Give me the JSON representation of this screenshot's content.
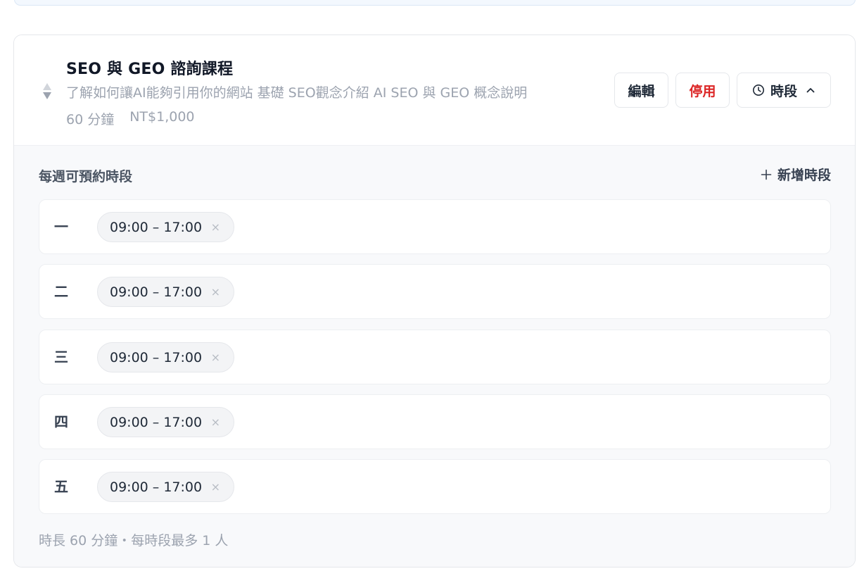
{
  "course": {
    "title": "SEO 與 GEO 諮詢課程",
    "description": "了解如何讓AI能夠引用你的網站 基礎 SEO觀念介紹 AI SEO 與 GEO 概念說明",
    "duration": "60 分鐘",
    "price": "NT$1,000"
  },
  "actions": {
    "edit_label": "編輯",
    "disable_label": "停用",
    "slots_label": "時段"
  },
  "schedule": {
    "title": "每週可預約時段",
    "add_label": "新增時段",
    "days": [
      {
        "label": "一",
        "slot": "09:00 – 17:00"
      },
      {
        "label": "二",
        "slot": "09:00 – 17:00"
      },
      {
        "label": "三",
        "slot": "09:00 – 17:00"
      },
      {
        "label": "四",
        "slot": "09:00 – 17:00"
      },
      {
        "label": "五",
        "slot": "09:00 – 17:00"
      }
    ],
    "remove_glyph": "×",
    "footnote": "時長 60 分鐘・每時段最多 1 人"
  },
  "colors": {
    "danger": "#dc2626",
    "muted": "#9ca3af",
    "panel": "#f8f9fb"
  },
  "icons": [
    "sort-icon",
    "clock-icon",
    "chevron-up-icon",
    "plus-icon",
    "close-icon"
  ]
}
